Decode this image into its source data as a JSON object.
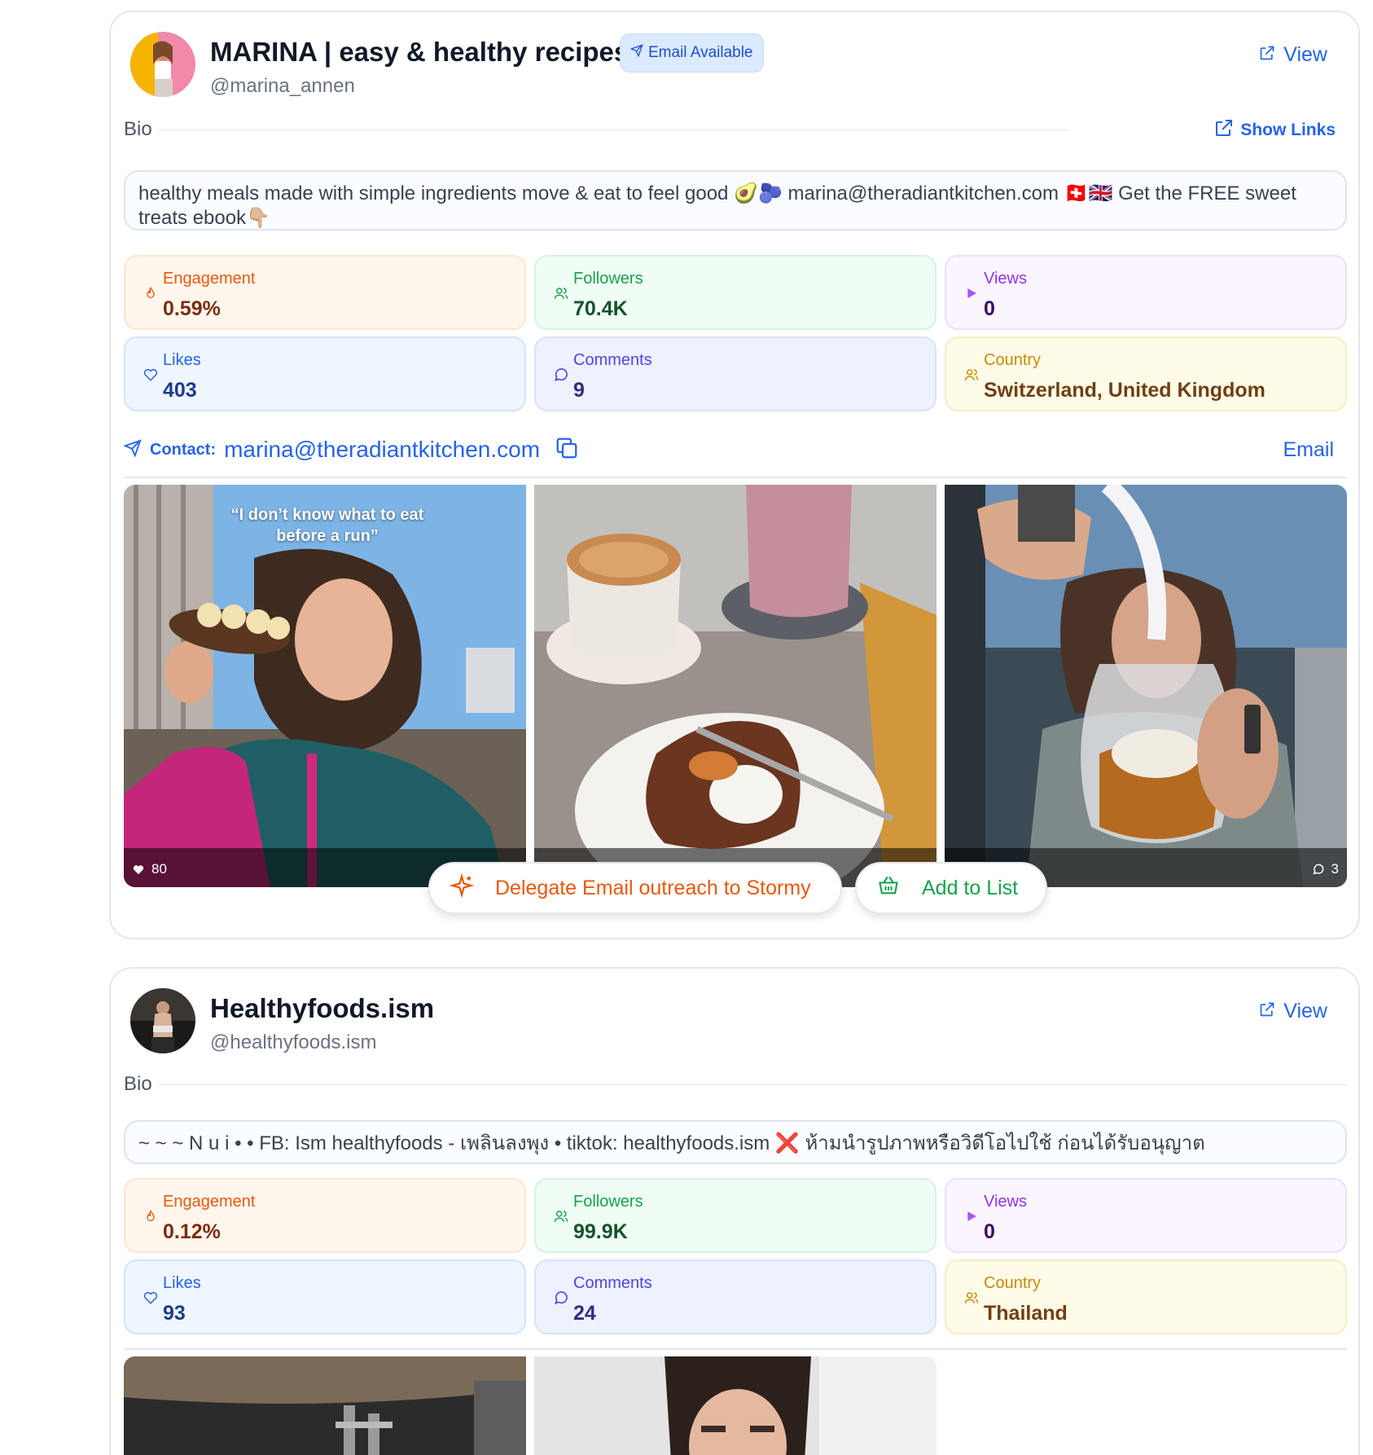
{
  "profiles": [
    {
      "name": "MARINA | easy & healthy recipes",
      "handle": "@marina_annen",
      "badge": "Email Available",
      "view_label": "View",
      "bio_label": "Bio",
      "show_links_label": "Show Links",
      "bio_text": "healthy meals made with simple ingredients move & eat to feel good 🥑🫐 marina@theradiantkitchen.com 🇨🇭🇬🇧 Get the FREE sweet treats ebook👇🏼",
      "stats": {
        "engagement": {
          "label": "Engagement",
          "value": "0.59%"
        },
        "followers": {
          "label": "Followers",
          "value": "70.4K"
        },
        "views": {
          "label": "Views",
          "value": "0"
        },
        "likes": {
          "label": "Likes",
          "value": "403"
        },
        "comments": {
          "label": "Comments",
          "value": "9"
        },
        "country": {
          "label": "Country",
          "value": "Switzerland, United Kingdom"
        }
      },
      "contact": {
        "label": "Contact:",
        "email": "marina@theradiantkitchen.com",
        "email_button": "Email"
      },
      "media": {
        "caption": "“I don’t know what to eat before a run”",
        "post1_likes": "80",
        "post3_comments": "3"
      },
      "actions": {
        "delegate": "Delegate Email outreach to Stormy",
        "add_to_list": "Add to List"
      }
    },
    {
      "name": "Healthyfoods.ism",
      "handle": "@healthyfoods.ism",
      "view_label": "View",
      "bio_label": "Bio",
      "bio_text": "~ ~ ~ N u i • • FB: Ism healthyfoods - เพลินลงพุง • tiktok: healthyfoods.ism ❌ ห้ามนำรูปภาพหรือวิดีโอไปใช้ ก่อนได้รับอนุญาต",
      "stats": {
        "engagement": {
          "label": "Engagement",
          "value": "0.12%"
        },
        "followers": {
          "label": "Followers",
          "value": "99.9K"
        },
        "views": {
          "label": "Views",
          "value": "0"
        },
        "likes": {
          "label": "Likes",
          "value": "93"
        },
        "comments": {
          "label": "Comments",
          "value": "24"
        },
        "country": {
          "label": "Country",
          "value": "Thailand"
        }
      }
    }
  ],
  "colors": {
    "link_blue": "#2563eb",
    "stormy_orange": "#ea580c",
    "list_green": "#16a34a"
  },
  "icons": [
    "send-icon",
    "external-link-icon",
    "flame-icon",
    "users-icon",
    "play-icon",
    "heart-icon",
    "comment-icon",
    "copy-icon",
    "sparkle-icon",
    "basket-icon"
  ]
}
